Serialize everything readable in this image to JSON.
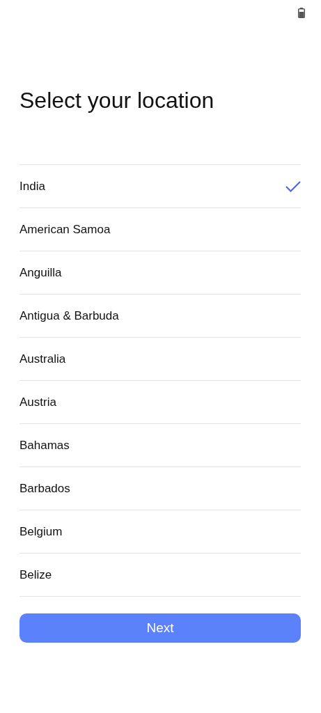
{
  "title": "Select your location",
  "locations": [
    {
      "name": "India",
      "selected": true
    },
    {
      "name": "American Samoa",
      "selected": false
    },
    {
      "name": "Anguilla",
      "selected": false
    },
    {
      "name": "Antigua & Barbuda",
      "selected": false
    },
    {
      "name": "Australia",
      "selected": false
    },
    {
      "name": "Austria",
      "selected": false
    },
    {
      "name": "Bahamas",
      "selected": false
    },
    {
      "name": "Barbados",
      "selected": false
    },
    {
      "name": "Belgium",
      "selected": false
    },
    {
      "name": "Belize",
      "selected": false
    }
  ],
  "next_button": "Next"
}
